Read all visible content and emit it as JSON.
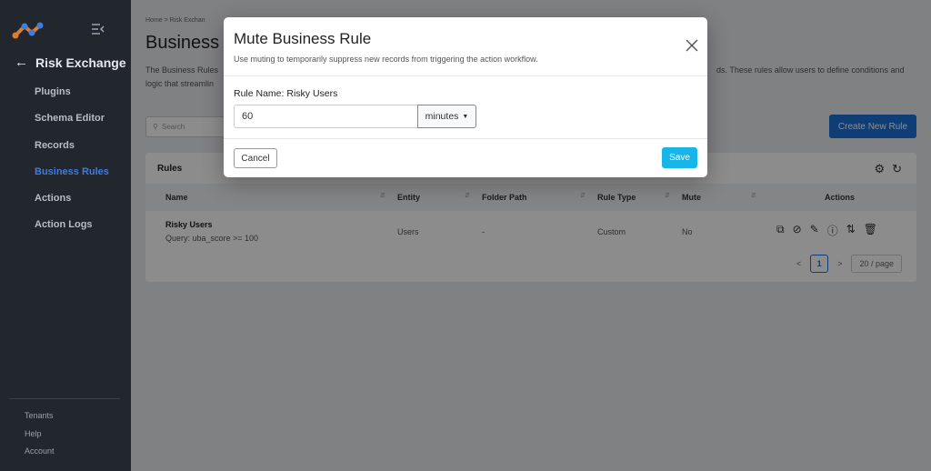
{
  "sidebar": {
    "title": "Risk Exchange",
    "items": [
      {
        "label": "Plugins"
      },
      {
        "label": "Schema Editor"
      },
      {
        "label": "Records"
      },
      {
        "label": "Business Rules"
      },
      {
        "label": "Actions"
      },
      {
        "label": "Action Logs"
      }
    ],
    "active_item": "Business Rules",
    "bottom": [
      {
        "label": "Tenants"
      },
      {
        "label": "Help"
      },
      {
        "label": "Account"
      }
    ]
  },
  "main": {
    "breadcrumb": "Home  >  Risk Exchan",
    "title": "Business R",
    "description_left": "The Business Rules logic that streamlin",
    "description_right": "ds. These rules allow users to define conditions and",
    "search_placeholder": "Search",
    "create_button": "Create New Rule",
    "card_title": "Rules",
    "columns": [
      "Name",
      "Entity",
      "Folder Path",
      "Rule Type",
      "Mute",
      "Actions"
    ],
    "rows": [
      {
        "name": "Risky Users",
        "query": "Query: uba_score >= 100",
        "entity": "Users",
        "folder_path": "-",
        "rule_type": "Custom",
        "mute": "No"
      }
    ],
    "pager": {
      "current_page": "1",
      "page_size": "20 / page",
      "prev": "<",
      "next": ">"
    }
  },
  "modal": {
    "title": "Mute Business Rule",
    "subtitle": "Use muting to temporarily suppress new records from triggering the action workflow.",
    "rule_name": "Rule Name: Risky Users",
    "duration_value": "60",
    "duration_unit": "minutes",
    "cancel_label": "Cancel",
    "save_label": "Save"
  },
  "colors": {
    "sidebar_bg": "#22262d",
    "active_nav": "#3d7de0",
    "primary": "#1d6fd8",
    "save_button": "#17b5e8"
  }
}
